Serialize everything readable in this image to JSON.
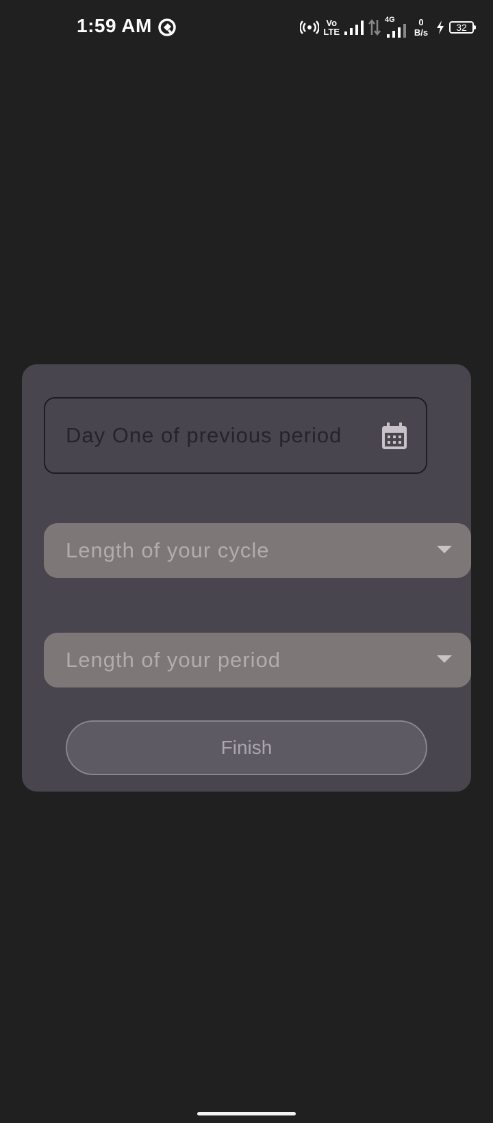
{
  "status_bar": {
    "time": "1:59 AM",
    "app_icon": "q-circle-icon",
    "volte_top": "Vo",
    "volte_bottom": "LTE",
    "network_type": "4G",
    "net_speed_value": "0",
    "net_speed_unit": "B/s",
    "battery_level": "32",
    "icons": [
      "hotspot-icon",
      "signal-icon",
      "data-arrows-icon",
      "signal-4g-icon",
      "charging-icon",
      "battery-icon"
    ]
  },
  "form": {
    "date_field_placeholder": "Day One of previous period",
    "date_field_icon": "calendar-icon",
    "cycle_dropdown_label": "Length of your cycle",
    "period_dropdown_label": "Length of your period",
    "finish_label": "Finish"
  },
  "colors": {
    "background": "#202020",
    "card": "#48454e",
    "dropdown": "#7d7877",
    "button": "#5d5a63"
  }
}
